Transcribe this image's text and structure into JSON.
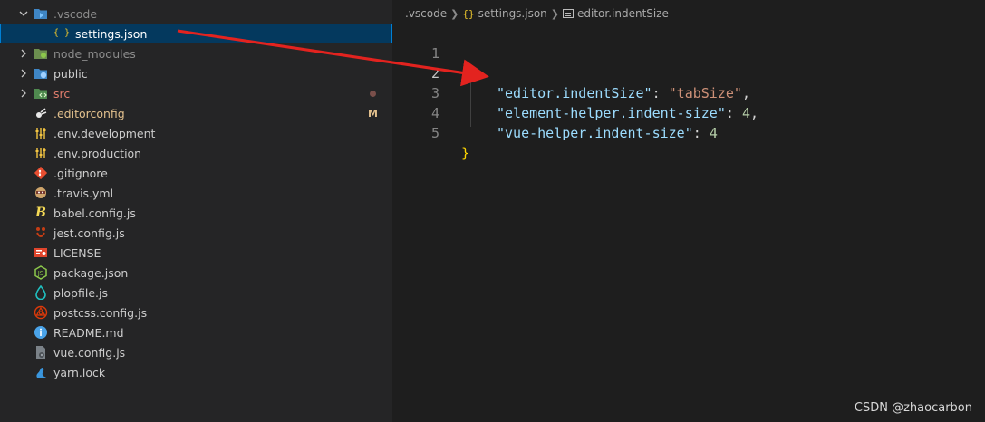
{
  "explorer": {
    "items": [
      {
        "label": ".vscode",
        "icon": "vscode-folder-icon",
        "type": "folder",
        "expanded": true,
        "style": "normal"
      },
      {
        "label": "settings.json",
        "icon": "json-icon",
        "type": "file",
        "selected": true,
        "style": "normal"
      },
      {
        "label": "node_modules",
        "icon": "node-folder-icon",
        "type": "folder",
        "expanded": false,
        "style": "dim"
      },
      {
        "label": "public",
        "icon": "public-folder-icon",
        "type": "folder",
        "expanded": false,
        "style": "normal"
      },
      {
        "label": "src",
        "icon": "src-folder-icon",
        "type": "folder",
        "expanded": false,
        "style": "src",
        "decoration": "dot"
      },
      {
        "label": ".editorconfig",
        "icon": "editorconfig-icon",
        "type": "file",
        "style": "modified",
        "decoration": "M"
      },
      {
        "label": ".env.development",
        "icon": "env-icon",
        "type": "file",
        "style": "normal"
      },
      {
        "label": ".env.production",
        "icon": "env-icon",
        "type": "file",
        "style": "normal"
      },
      {
        "label": ".gitignore",
        "icon": "git-icon",
        "type": "file",
        "style": "normal"
      },
      {
        "label": ".travis.yml",
        "icon": "travis-icon",
        "type": "file",
        "style": "normal"
      },
      {
        "label": "babel.config.js",
        "icon": "babel-icon",
        "type": "file",
        "style": "normal"
      },
      {
        "label": "jest.config.js",
        "icon": "jest-icon",
        "type": "file",
        "style": "normal"
      },
      {
        "label": "LICENSE",
        "icon": "license-icon",
        "type": "file",
        "style": "normal"
      },
      {
        "label": "package.json",
        "icon": "nodejs-icon",
        "type": "file",
        "style": "normal"
      },
      {
        "label": "plopfile.js",
        "icon": "plop-icon",
        "type": "file",
        "style": "normal"
      },
      {
        "label": "postcss.config.js",
        "icon": "postcss-icon",
        "type": "file",
        "style": "normal"
      },
      {
        "label": "README.md",
        "icon": "info-icon",
        "type": "file",
        "style": "normal"
      },
      {
        "label": "vue.config.js",
        "icon": "vue-config-icon",
        "type": "file",
        "style": "normal"
      },
      {
        "label": "yarn.lock",
        "icon": "yarn-icon",
        "type": "file",
        "style": "normal"
      }
    ],
    "decorations": {
      "modified_badge": "M"
    }
  },
  "breadcrumbs": {
    "folder": ".vscode",
    "json_icon_glyph": "{}",
    "file": "settings.json",
    "symbol": "editor.indentSize"
  },
  "editor": {
    "active_line": 2,
    "lines": [
      {
        "number": "1",
        "open_brace": "{"
      },
      {
        "number": "2",
        "key": "\"editor.indentSize\"",
        "colon": ": ",
        "value": "\"tabSize\"",
        "value_type": "string",
        "comma": ","
      },
      {
        "number": "3",
        "key": "\"element-helper.indent-size\"",
        "colon": ": ",
        "value": "4",
        "value_type": "number",
        "comma": ","
      },
      {
        "number": "4",
        "key": "\"vue-helper.indent-size\"",
        "colon": ": ",
        "value": "4",
        "value_type": "number",
        "comma": ""
      },
      {
        "number": "5",
        "close_brace": "}"
      }
    ]
  },
  "watermark": "CSDN @zhaocarbon",
  "colors": {
    "sidebar_bg": "#252526",
    "editor_bg": "#1e1e1e",
    "selection_bg": "#04395e",
    "selection_border": "#007fd4",
    "annotation_arrow": "#e3231f",
    "json_key": "#9cdcfe",
    "json_string": "#ce9178",
    "json_number": "#b5cea8",
    "brace": "#ffd700"
  }
}
